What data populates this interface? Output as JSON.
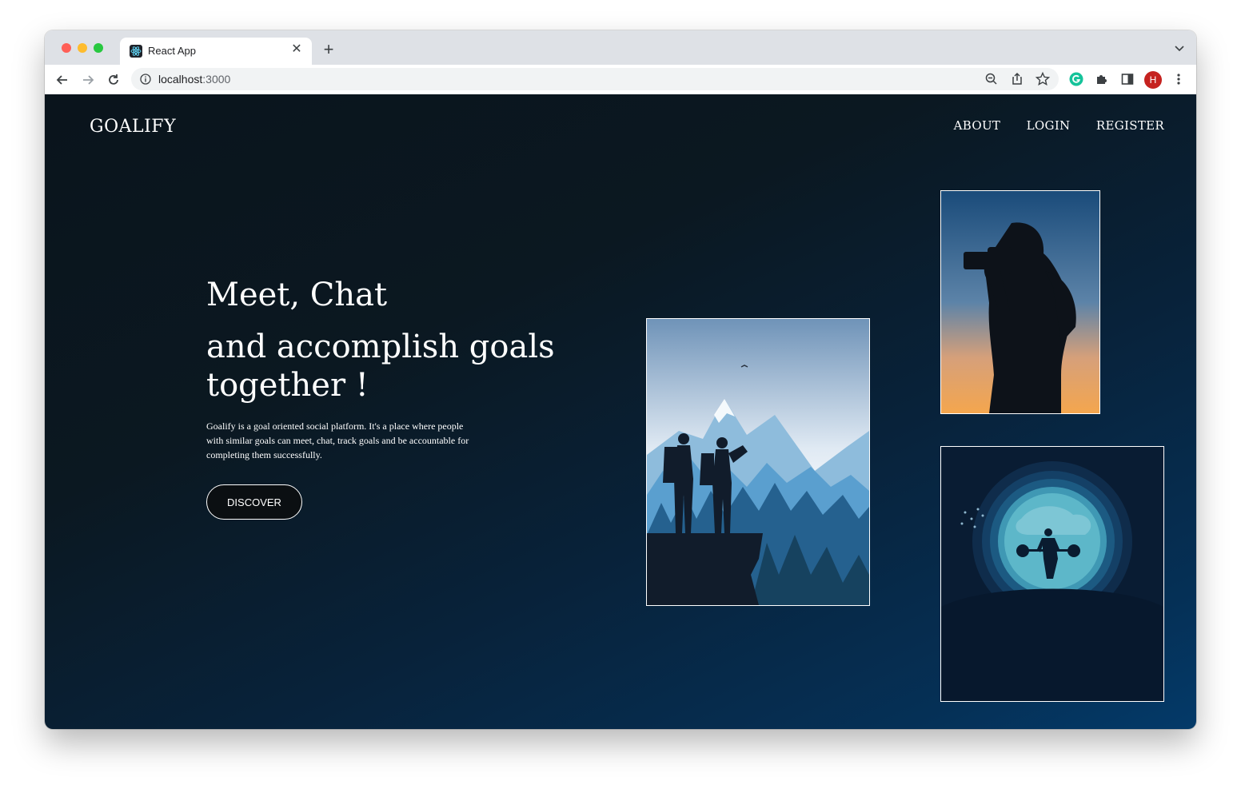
{
  "browser": {
    "tab_title": "React App",
    "url_host": "localhost",
    "url_port": ":3000",
    "avatar_letter": "H"
  },
  "site": {
    "logo": "GOALIFY",
    "nav": {
      "about": "ABOUT",
      "login": "LOGIN",
      "register": "REGISTER"
    },
    "hero": {
      "line1": "Meet, Chat",
      "line2": "and accomplish goals together !",
      "description": "Goalify is a goal oriented social platform. It's a place where people with similar goals can meet, chat, track goals and be accountable for completing them successfully.",
      "cta": "DISCOVER"
    }
  },
  "colors": {
    "page_bg_dark": "#0a141c",
    "page_bg_light": "#043a69",
    "text": "#ffffff",
    "button_bg": "#0b0f12"
  },
  "icons": {
    "back": "arrow-left-icon",
    "forward": "arrow-right-icon",
    "reload": "reload-icon",
    "zoom": "zoom-out-icon",
    "share": "share-icon",
    "bookmark": "star-icon",
    "grammarly": "grammarly-icon",
    "extensions": "puzzle-icon",
    "sidepanel": "side-panel-icon",
    "menu": "kebab-menu-icon"
  }
}
